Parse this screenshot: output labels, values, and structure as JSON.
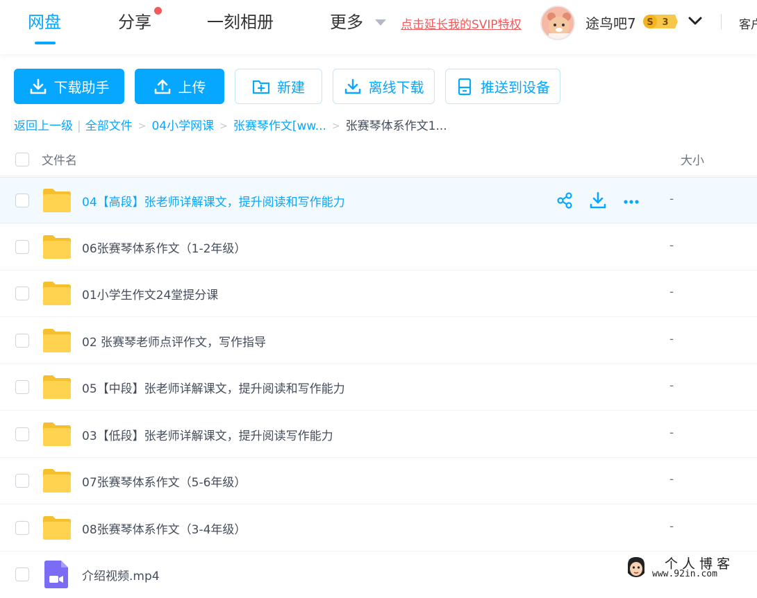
{
  "nav": {
    "tabs": [
      {
        "label": "网盘",
        "active": true
      },
      {
        "label": "分享",
        "badge": "red-dot"
      },
      {
        "label": "一刻相册"
      },
      {
        "label": "更多"
      }
    ],
    "svip_link": "点击延长我的SVIP特权",
    "username": "途鸟吧7",
    "vip_badge_letter": "S",
    "vip_level": "3",
    "client_label": "客户"
  },
  "toolbar": {
    "download_helper": "下载助手",
    "upload": "上传",
    "new": "新建",
    "offline_download": "离线下载",
    "push_to_device": "推送到设备"
  },
  "breadcrumb": {
    "back": "返回上一级",
    "items": [
      "全部文件",
      "04小学网课",
      "张赛琴作文[ww..."
    ],
    "current": "张赛琴体系作文1..."
  },
  "list": {
    "header_name": "文件名",
    "header_size": "大小",
    "rows": [
      {
        "name": "04【高段】张老师详解课文，提升阅读和写作能力",
        "size": "-",
        "type": "folder"
      },
      {
        "name": "06张赛琴体系作文（1-2年级）",
        "size": "-",
        "type": "folder"
      },
      {
        "name": "01小学生作文24堂提分课",
        "size": "-",
        "type": "folder"
      },
      {
        "name": "02 张赛琴老师点评作文，写作指导",
        "size": "-",
        "type": "folder"
      },
      {
        "name": "05【中段】张老师详解课文，提升阅读和写作能力",
        "size": "-",
        "type": "folder"
      },
      {
        "name": "03【低段】张老师详解课文，提升阅读写作能力",
        "size": "-",
        "type": "folder"
      },
      {
        "name": "07张赛琴体系作文（5-6年级）",
        "size": "-",
        "type": "folder"
      },
      {
        "name": "08张赛琴体系作文（3-4年级）",
        "size": "-",
        "type": "folder"
      },
      {
        "name": "介绍视频.mp4",
        "size": "",
        "type": "video"
      }
    ]
  },
  "watermark": {
    "title": "个人博客",
    "url": "www.92in.com"
  },
  "colors": {
    "accent": "#06a7ff",
    "svip_red": "#f05a5a",
    "folder_yellow": "#ffd34f",
    "video_purple": "#7b6cf6"
  }
}
